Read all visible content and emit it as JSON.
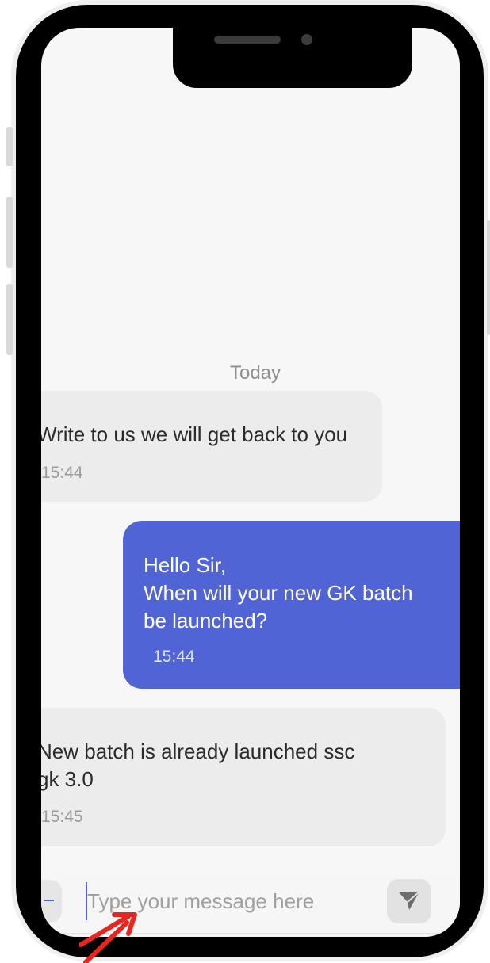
{
  "chat": {
    "date_separator": "Today",
    "messages": [
      {
        "direction": "incoming",
        "text": "Write to us we will get back to you",
        "time": "15:44"
      },
      {
        "direction": "outgoing",
        "lines": [
          "Hello Sir,",
          "When will your new GK batch",
          "be launched?"
        ],
        "time": "15:44"
      },
      {
        "direction": "incoming",
        "lines": [
          "New batch is already launched ssc",
          "gk 3.0"
        ],
        "time": "15:45"
      }
    ]
  },
  "composer": {
    "placeholder": "Type your message here",
    "send_icon": "send-icon",
    "attach_icon": "attach-icon"
  },
  "colors": {
    "outgoing_bubble": "#5164d6",
    "incoming_bubble": "#ececec",
    "annotation_arrow": "#e8261f"
  }
}
